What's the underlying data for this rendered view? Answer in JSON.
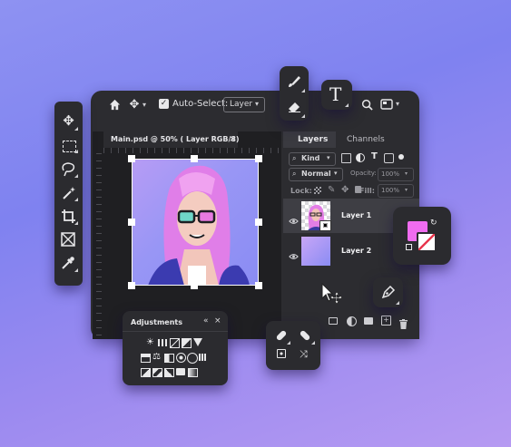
{
  "toolbar": {
    "auto_select_label": "Auto-Select:",
    "layer_select_value": "Layer"
  },
  "document": {
    "tab_title": "Main.psd @ 50% ( Layer RGB/8)",
    "close_glyph": "×"
  },
  "layers_panel": {
    "tab_layers": "Layers",
    "tab_channels": "Channels",
    "filter_label": "Kind",
    "blend_mode": "Normal",
    "opacity_label": "Opacity:",
    "opacity_value": "100%",
    "lock_label": "Lock:",
    "fill_label": "Fill:",
    "fill_value": "100%",
    "layers": [
      {
        "name": "Layer 1"
      },
      {
        "name": "Layer 2"
      }
    ]
  },
  "adjustments": {
    "title": "Adjustments",
    "collapse_glyph": "«",
    "close_glyph": "×"
  },
  "type_tool_glyph": "T",
  "icons": [
    "home-icon",
    "move-icon",
    "checkbox-icon",
    "search-icon",
    "screen-mode-icon",
    "visibility-icon",
    "pen-icon",
    "eraser-icon",
    "brush-icon",
    "crop-icon",
    "lasso-icon",
    "marquee-icon",
    "magic-wand-icon",
    "eyedropper-icon",
    "frame-icon"
  ],
  "colors": {
    "background_start": "#8e92f2",
    "background_end": "#b69af2",
    "panel": "#2a2a2e",
    "canvas": "#1f1f22",
    "selected_layer": "#3c3c42",
    "swatch_pink": "#f06cf0"
  }
}
